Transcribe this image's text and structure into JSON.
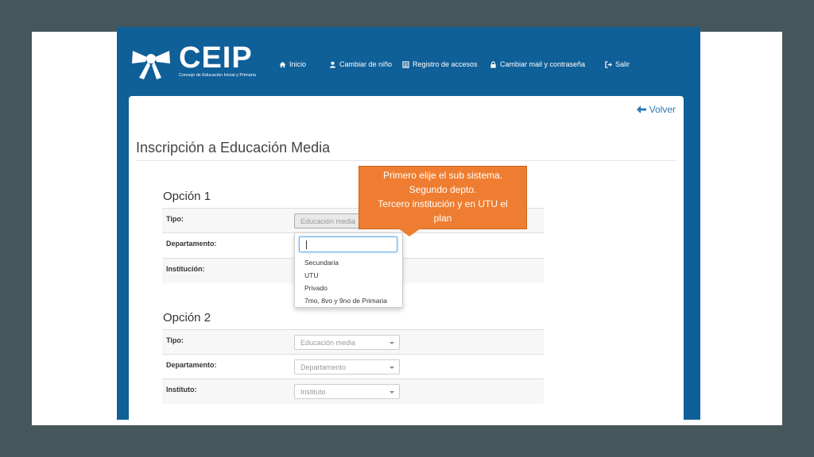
{
  "logo": {
    "text": "CEIP",
    "subtitle": "Consejo de Educación Inicial y Primaria"
  },
  "nav": {
    "items": [
      {
        "label": "Inicio",
        "icon": "home-icon"
      },
      {
        "label": "Cambiar de niño",
        "icon": "user-icon"
      },
      {
        "label": "Registro de accesos",
        "icon": "list-icon"
      },
      {
        "label": "Cambiar mail y contraseña",
        "icon": "lock-icon"
      },
      {
        "label": "Salir",
        "icon": "logout-icon"
      }
    ]
  },
  "page": {
    "back_label": "Volver",
    "title": "Inscripción a Educación Media"
  },
  "opcion1": {
    "heading": "Opción 1",
    "tipo_label": "Tipo:",
    "tipo_value": "Educación media",
    "departamento_label": "Departamento:",
    "institucion_label": "Institución:"
  },
  "dropdown": {
    "search_value": "",
    "options": [
      "Secundaria",
      "UTU",
      "Privado",
      "7mo, 8vo y 9no de Primaria"
    ]
  },
  "opcion2": {
    "heading": "Opción 2",
    "tipo_label": "Tipo:",
    "tipo_value": "Educación media",
    "departamento_label": "Departamento:",
    "departamento_value": "Departamento",
    "instituto_label": "Instituto:",
    "instituto_value": "Instituto"
  },
  "callout": {
    "lines": [
      "Primero elije el sub sistema.",
      "Segundo depto.",
      "Tercero institución y en UTU el",
      "plan"
    ]
  },
  "colors": {
    "header_blue": "#0f5f98",
    "callout_orange": "#ef7d31",
    "link_blue": "#2f78b6"
  }
}
